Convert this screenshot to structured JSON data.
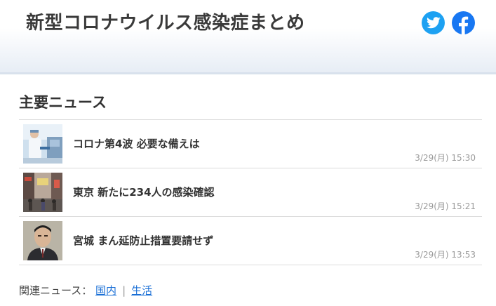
{
  "header": {
    "title": "新型コロナウイルス感染症まとめ",
    "social": [
      {
        "icon": "twitter-icon",
        "color": "#1da1f2"
      },
      {
        "icon": "facebook-icon",
        "color": "#1877f2"
      }
    ]
  },
  "main": {
    "section_title": "主要ニュース",
    "news": [
      {
        "headline": "コロナ第4波 必要な備えは",
        "time": "3/29(月) 15:30"
      },
      {
        "headline": "東京 新たに234人の感染確認",
        "time": "3/29(月) 15:21"
      },
      {
        "headline": "宮城 まん延防止措置要請せず",
        "time": "3/29(月) 13:53"
      }
    ]
  },
  "related": {
    "label": "関連ニュース：",
    "links": [
      "国内",
      "生活"
    ],
    "separator": "|"
  },
  "colors": {
    "link": "#1a6fd6",
    "timestamp": "#9a9a9a",
    "twitter": "#1da1f2",
    "facebook": "#1877f2"
  }
}
